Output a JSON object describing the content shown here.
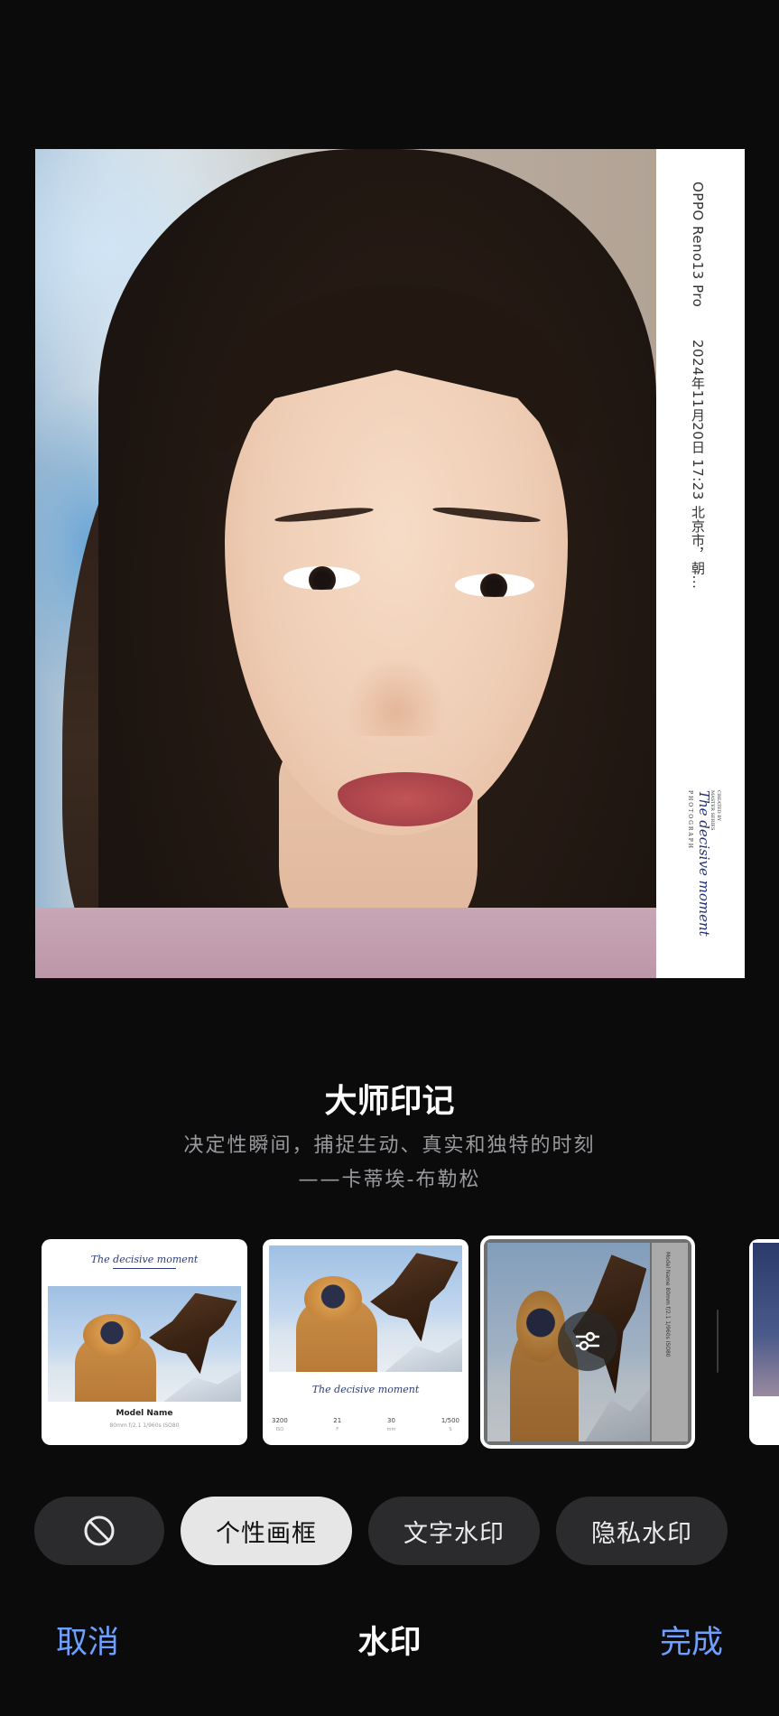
{
  "preview": {
    "camera_model": "OPPO Reno13 Pro",
    "datetime_location": "2024年11月20日 17:23 北京市，朝...",
    "signature_logo": "The decisive moment",
    "logo_caption_1": "CREATED BY",
    "logo_caption_2": "MASTER SERIES",
    "logo_caption_3": "PHOTOGRAPH"
  },
  "style": {
    "title": "大师印记",
    "quote_line1": "决定性瞬间，捕捉生动、真实和独特的时刻",
    "quote_line2": "——卡蒂埃-布勒松"
  },
  "thumbnails": {
    "t1": {
      "logo": "The decisive moment",
      "name": "Model Name",
      "params": "80mm  f/2.1  1/960s  ISO80"
    },
    "t2": {
      "logo": "The decisive moment",
      "cells": [
        {
          "value": "3200",
          "unit": "ISO"
        },
        {
          "value": "21",
          "unit": "F"
        },
        {
          "value": "30",
          "unit": "mm"
        },
        {
          "value": "1/500",
          "unit": "S"
        }
      ]
    },
    "t3": {
      "side_text": "Model Name  80mm  f/2.1  1/960s  ISO80"
    }
  },
  "categories": {
    "none_icon": "no-watermark-icon",
    "items": [
      {
        "label": "个性画框",
        "selected": true
      },
      {
        "label": "文字水印",
        "selected": false
      },
      {
        "label": "隐私水印",
        "selected": false
      }
    ]
  },
  "bottom_bar": {
    "cancel": "取消",
    "title": "水印",
    "done": "完成"
  },
  "colors": {
    "background": "#0b0b0c",
    "accent": "#6ea0ff",
    "pill": "#2b2b2d",
    "pill_selected": "#e6e6e6"
  }
}
